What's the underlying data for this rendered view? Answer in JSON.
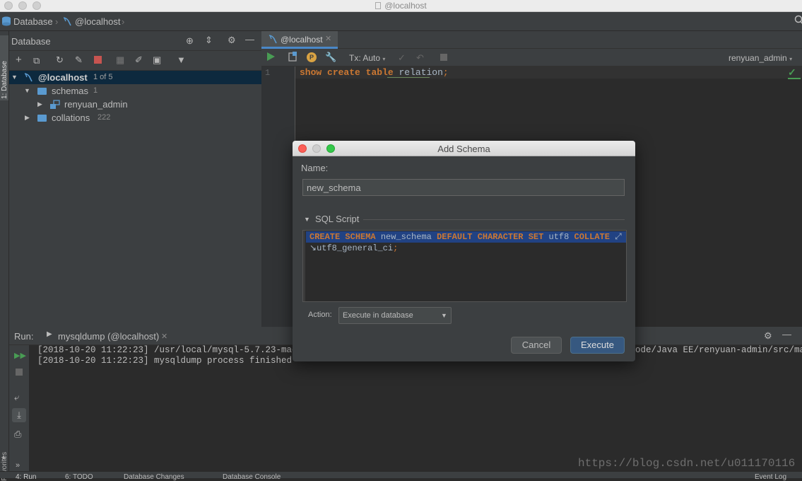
{
  "window": {
    "title": "@localhost"
  },
  "nav": {
    "database": "Database",
    "host": "@localhost"
  },
  "leftstrip": {
    "database_label": "1: Database",
    "favorites_label": "Favorites"
  },
  "db_panel": {
    "title": "Database",
    "tree": {
      "host": "@localhost",
      "host_count": "1 of 5",
      "schemas": "schemas",
      "schemas_count": "1",
      "schema_item": "renyuan_admin",
      "collations": "collations",
      "collations_count": "222"
    }
  },
  "editor": {
    "tab_label": "@localhost",
    "tx_label": "Tx: Auto",
    "user": "renyuan_admin",
    "line_number": "1",
    "code": {
      "kw1": "show",
      "kw2": "create",
      "kw3": "table",
      "ident": "relation",
      "punct": ";"
    }
  },
  "run": {
    "label": "Run:",
    "tab": "mysqldump (@localhost)",
    "line1_left": "[2018-10-20 11:22:23] /usr/local/mysql-5.7.23-macos1",
    "line1_right": "ode/Java EE/renyuan-admin/src/mai",
    "line2": "[2018-10-20 11:22:23] mysqldump process finished"
  },
  "bottom": {
    "run": "4: Run",
    "todo": "6: TODO",
    "changes": "Database Changes",
    "console": "Database Console",
    "event_log": "Event Log"
  },
  "watermark": "https://blog.csdn.net/u011170116",
  "dialog": {
    "title": "Add Schema",
    "name_label": "Name:",
    "name_value": "new_schema",
    "sql_section": "SQL Script",
    "sql": {
      "kw_create": "CREATE",
      "kw_schema": "SCHEMA",
      "name": "new_schema",
      "kw_default": "DEFAULT",
      "kw_character": "CHARACTER",
      "kw_set": "SET",
      "charset": "utf8",
      "kw_collate": "COLLATE",
      "collation": "utf8_general_ci",
      "end": ";"
    },
    "action_label": "Action:",
    "action_value": "Execute in database",
    "cancel": "Cancel",
    "execute": "Execute"
  },
  "colors": {
    "accent": "#4a88c7",
    "keyword": "#cc7832",
    "selection": "#214283",
    "run_green": "#499c54",
    "stop_red": "#c75450"
  }
}
